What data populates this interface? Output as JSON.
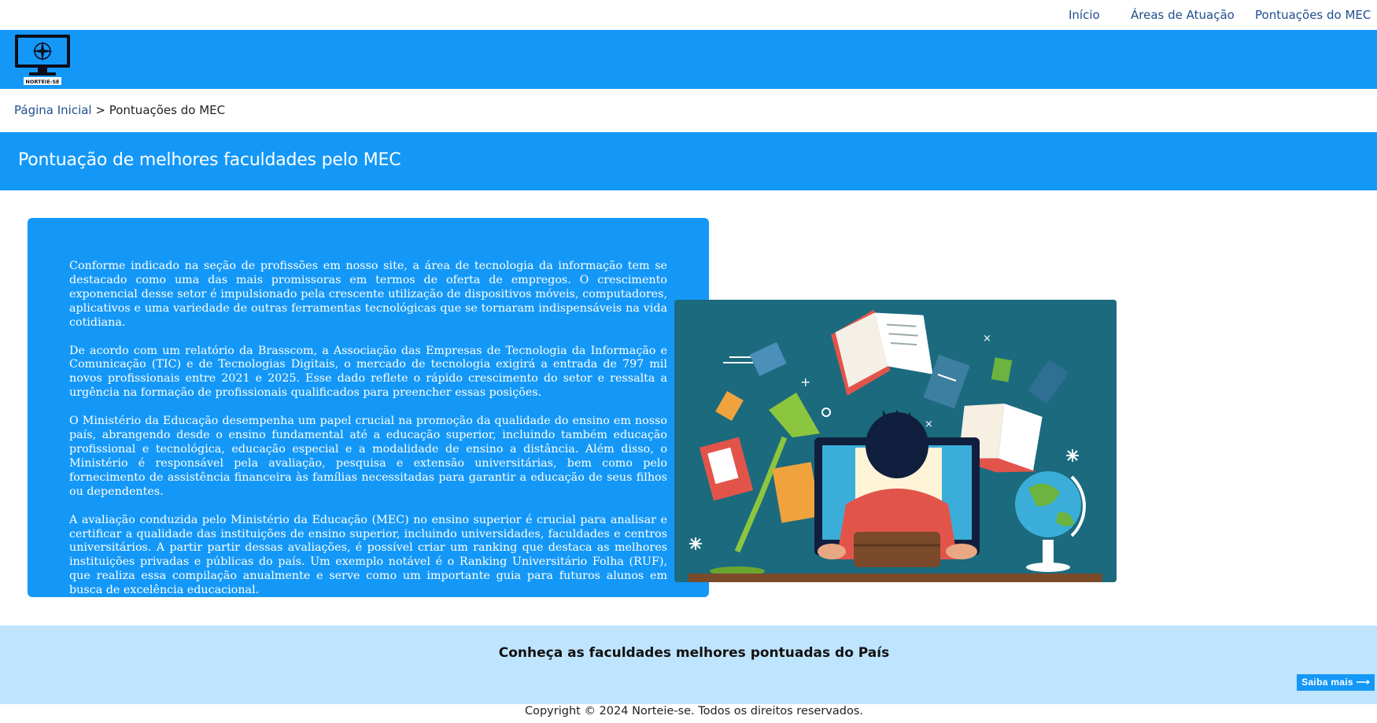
{
  "nav": {
    "items": [
      {
        "label": "Início"
      },
      {
        "label": "Áreas de Atuação"
      },
      {
        "label": "Pontuações do MEC"
      }
    ]
  },
  "logo": {
    "text": "NORTEIE-SE"
  },
  "breadcrumb": {
    "home": "Página Inicial",
    "separator": ">",
    "current": "Pontuações do MEC"
  },
  "page": {
    "title": "Pontuação de melhores faculdades pelo MEC"
  },
  "content": {
    "paragraphs": [
      "Conforme indicado na seção de profissões em nosso site, a área de tecnologia da informação tem se destacado como uma das mais promissoras em termos de oferta de empregos. O crescimento exponencial desse setor é impulsionado pela crescente utilização de dispositivos móveis, computadores, aplicativos e uma variedade de outras ferramentas tecnológicas que se tornaram indispensáveis na vida cotidiana.",
      "De acordo com um relatório da Brasscom, a Associação das Empresas de Tecnologia da Informação e Comunicação (TIC) e de Tecnologias Digitais, o mercado de tecnologia exigirá a entrada de 797 mil novos profissionais entre 2021 e 2025. Esse dado reflete o rápido crescimento do setor e ressalta a urgência na formação de profissionais qualificados para preencher essas posições.",
      "O Ministério da Educação desempenha um papel crucial na promoção da qualidade do ensino em nosso país, abrangendo desde o ensino fundamental até a educação superior, incluindo também educação profissional e tecnológica, educação especial e a modalidade de ensino a distância. Além disso, o Ministério é responsável pela avaliação, pesquisa e extensão universitárias, bem como pelo fornecimento de assistência financeira às famílias necessitadas para garantir a educação de seus filhos ou dependentes.",
      "A avaliação conduzida pelo Ministério da Educação (MEC) no ensino superior é crucial para analisar e certificar a qualidade das instituições de ensino superior, incluindo universidades, faculdades e centros universitários. A partir partir dessas avaliações, é possível criar um ranking que destaca as melhores instituições privadas e públicas do país. Um exemplo notável é o Ranking Universitário Folha (RUF), que realiza essa compilação anualmente e serve como um importante guia para futuros alunos em busca de excelência educacional."
    ]
  },
  "cta": {
    "heading": "Conheça as faculdades melhores pontuadas do País",
    "button_label": "Saiba mais ⟶"
  },
  "footer": {
    "copyright": "Copyright © 2024 Norteie-se. Todos os direitos reservados."
  },
  "colors": {
    "brand_blue": "#1498f7",
    "light_blue": "#bfe4fd",
    "link": "#1f4e8c",
    "illustration_bg": "#1b6a7e"
  }
}
